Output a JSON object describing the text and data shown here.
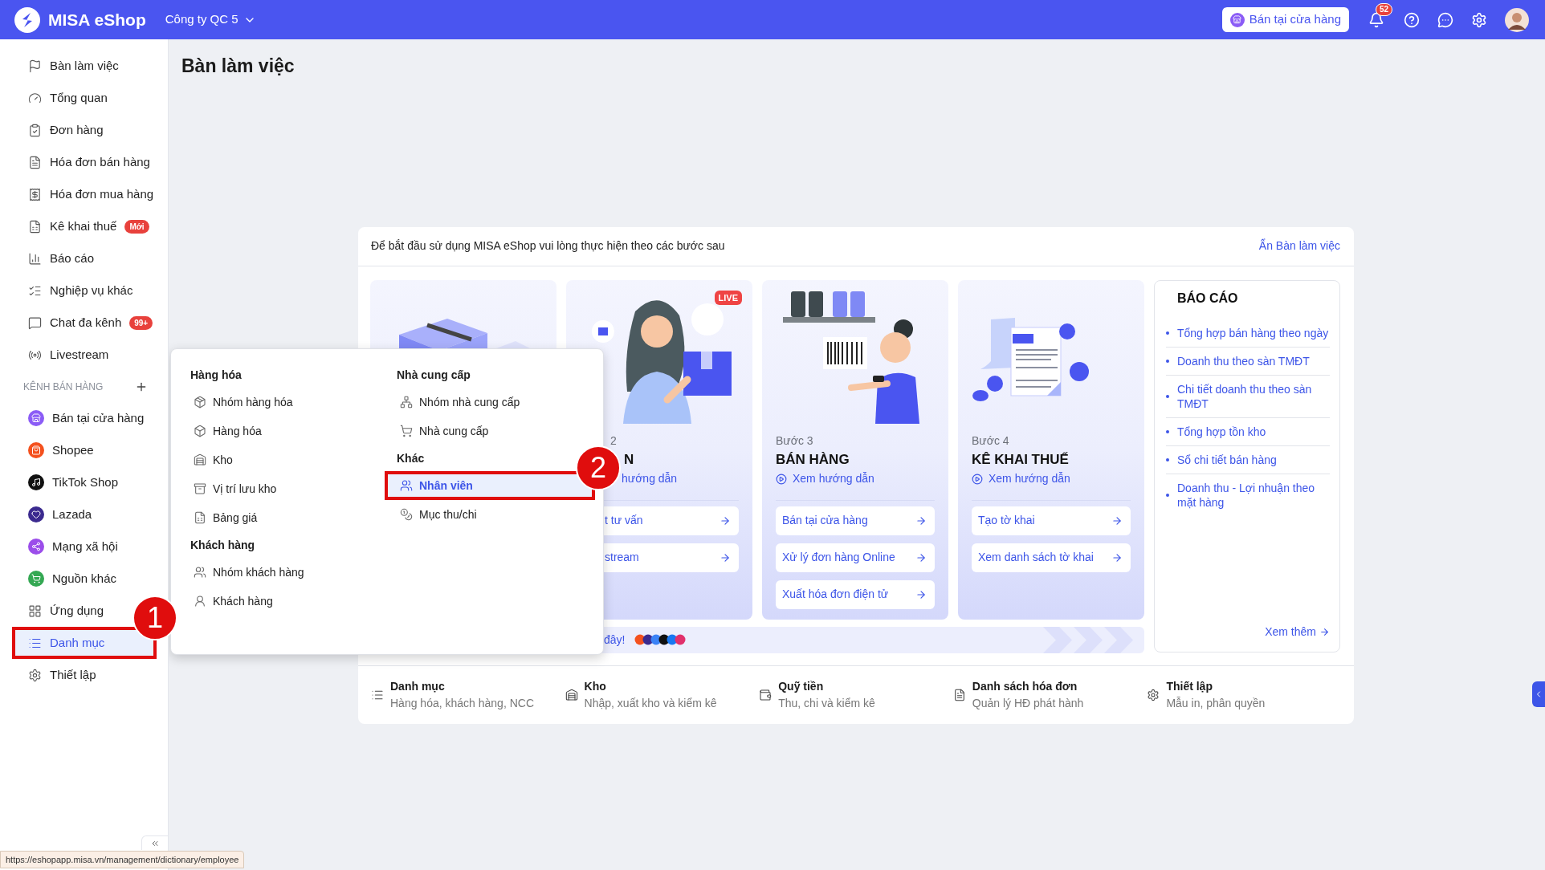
{
  "topbar": {
    "logo_text": "MISA eShop",
    "company": "Công ty QC 5",
    "store_button": "Bán tại cửa hàng",
    "notification_count": "52"
  },
  "sidebar": {
    "items": [
      {
        "label": "Bàn làm việc",
        "selected": false
      },
      {
        "label": "Tổng quan",
        "selected": false
      },
      {
        "label": "Đơn hàng",
        "selected": false
      },
      {
        "label": "Hóa đơn bán hàng",
        "selected": false
      },
      {
        "label": "Hóa đơn mua hàng",
        "selected": false
      },
      {
        "label": "Kê khai thuế",
        "selected": false,
        "badge": "Mới"
      },
      {
        "label": "Báo cáo",
        "selected": false
      },
      {
        "label": "Nghiệp vụ khác",
        "selected": false
      },
      {
        "label": "Chat đa kênh",
        "selected": false,
        "badge": "99+"
      },
      {
        "label": "Livestream",
        "selected": false
      }
    ],
    "section": {
      "title": "KÊNH BÁN HÀNG",
      "channels": [
        {
          "label": "Bán tại cửa hàng",
          "selected": false,
          "color": "#8b5cf6"
        },
        {
          "label": "Shopee",
          "selected": false,
          "color": "#f4511e"
        },
        {
          "label": "TikTok Shop",
          "selected": false,
          "color": "#111111"
        },
        {
          "label": "Lazada",
          "selected": false,
          "color": "#3b2a8f"
        },
        {
          "label": "Mạng xã hội",
          "selected": false,
          "color": "#9b4dea"
        },
        {
          "label": "Nguồn khác",
          "selected": false,
          "color": "#34a853"
        }
      ]
    },
    "bottom_items": [
      {
        "label": "Ứng dụng",
        "selected": false
      },
      {
        "label": "Danh mục",
        "selected": true,
        "callout": "1"
      },
      {
        "label": "Thiết lập",
        "selected": false
      }
    ]
  },
  "page_title": "Bàn làm việc",
  "getting_started": {
    "intro": "Để bắt đầu sử dụng MISA eShop vui lòng thực hiện theo các bước sau",
    "hide_link": "Ẩn Bàn làm việc",
    "steps": [
      {
        "kind": "picture_only"
      },
      {
        "kind": "partial",
        "step": "2",
        "title": "N",
        "guide": "hướng dẫn",
        "live_badge": "LIVE",
        "actions": [
          "t tư vấn",
          "stream"
        ]
      },
      {
        "kind": "full",
        "step": "Bước 3",
        "title": "BÁN HÀNG",
        "guide": "Xem hướng dẫn",
        "actions": [
          "Bán tại cửa hàng",
          "Xử lý đơn hàng Online",
          "Xuất hóa đơn điện tử"
        ]
      },
      {
        "kind": "full",
        "step": "Bước 4",
        "title": "KÊ KHAI THUẾ",
        "guide": "Xem hướng dẫn",
        "actions": [
          "Tạo tờ khai",
          "Xem danh sách tờ khai"
        ]
      }
    ],
    "banner": {
      "text": "đây!"
    },
    "reports": {
      "title": "BÁO CÁO",
      "items": [
        "Tổng hợp bán hàng theo ngày",
        "Doanh thu theo sàn TMĐT",
        "Chi tiết doanh thu theo sàn TMĐT",
        "Tổng hợp tồn kho",
        "Sổ chi tiết bán hàng",
        "Doanh thu - Lợi nhuận theo mặt hàng"
      ],
      "more": "Xem thêm"
    },
    "shortcuts": [
      {
        "title": "Danh mục",
        "subtitle": "Hàng hóa, khách hàng, NCC"
      },
      {
        "title": "Kho",
        "subtitle": "Nhập, xuất kho và kiểm kê"
      },
      {
        "title": "Quỹ tiền",
        "subtitle": "Thu, chi và kiểm kê"
      },
      {
        "title": "Danh sách hóa đơn",
        "subtitle": "Quản lý HĐ phát hành"
      },
      {
        "title": "Thiết lập",
        "subtitle": "Mẫu in, phân quyền"
      }
    ]
  },
  "dropdown": {
    "columns": [
      {
        "groups": [
          {
            "title": "Hàng hóa",
            "items": [
              {
                "label": "Nhóm hàng hóa",
                "selected": false
              },
              {
                "label": "Hàng hóa",
                "selected": false
              },
              {
                "label": "Kho",
                "selected": false
              },
              {
                "label": "Vị trí lưu kho",
                "selected": false
              },
              {
                "label": "Bảng giá",
                "selected": false
              }
            ]
          },
          {
            "title": "Khách hàng",
            "items": [
              {
                "label": "Nhóm khách hàng",
                "selected": false
              },
              {
                "label": "Khách hàng",
                "selected": false
              }
            ]
          }
        ]
      },
      {
        "groups": [
          {
            "title": "Nhà cung cấp",
            "items": [
              {
                "label": "Nhóm nhà cung cấp",
                "selected": false
              },
              {
                "label": "Nhà cung cấp",
                "selected": false
              }
            ]
          },
          {
            "title": "Khác",
            "items": [
              {
                "label": "Nhân viên",
                "selected": true,
                "callout": "2"
              },
              {
                "label": "Mục thu/chi",
                "selected": false
              }
            ]
          }
        ]
      }
    ]
  },
  "status_url": "https://eshopapp.misa.vn/management/dictionary/employee"
}
